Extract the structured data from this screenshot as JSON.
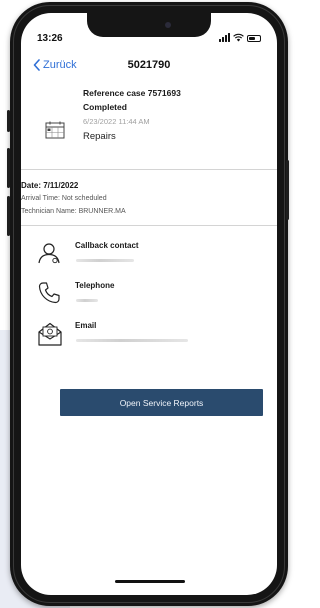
{
  "status_bar": {
    "time": "13:26",
    "icons": [
      "signal-icon",
      "wifi-icon",
      "battery-icon"
    ]
  },
  "nav": {
    "back_label": "Zurück",
    "title": "5021790"
  },
  "case": {
    "reference": "Reference case 7571693",
    "status": "Completed",
    "datetime": "6/23/2022 11:44 AM",
    "type": "Repairs",
    "icon": "calendar-icon"
  },
  "visit": {
    "date": "Date: 7/11/2022",
    "arrival": "Arrival Time: Not scheduled",
    "technician": "Technician Name: BRUNNER.MA"
  },
  "contacts": [
    {
      "label": "Callback contact",
      "icon": "person-icon"
    },
    {
      "label": "Telephone",
      "icon": "phone-icon"
    },
    {
      "label": "Email",
      "icon": "envelope-icon"
    }
  ],
  "actions": {
    "open_reports_label": "Open Service Reports"
  },
  "colors": {
    "accent": "#2f6fd6",
    "button": "#2a4b6e",
    "phone_frame": "#151515",
    "background_panel": "#e9ecf4"
  }
}
